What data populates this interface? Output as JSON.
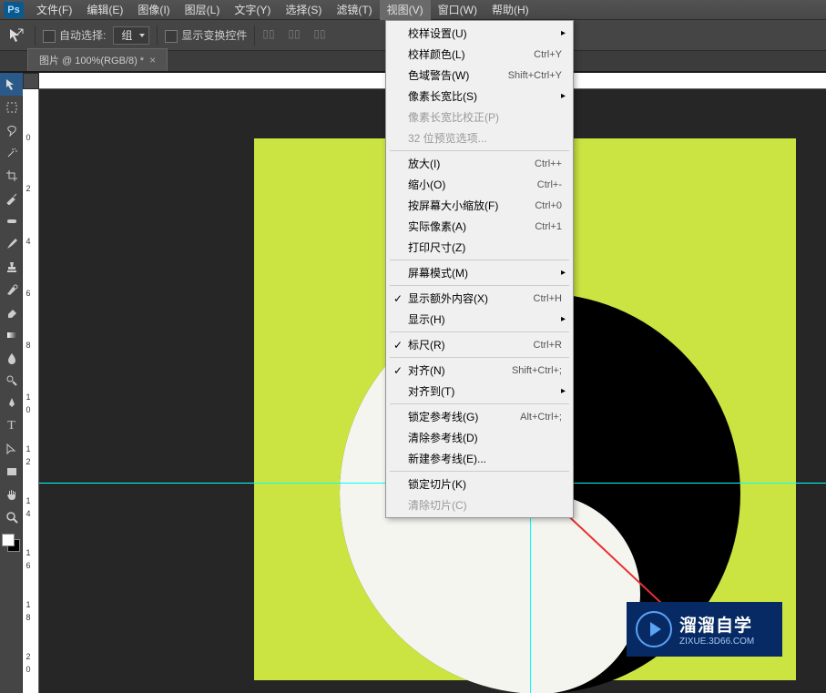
{
  "app_logo": "Ps",
  "menubar": [
    "文件(F)",
    "编辑(E)",
    "图像(I)",
    "图层(L)",
    "文字(Y)",
    "选择(S)",
    "滤镜(T)",
    "视图(V)",
    "窗口(W)",
    "帮助(H)"
  ],
  "active_menu_index": 7,
  "options": {
    "auto_select_label": "自动选择:",
    "group_label": "组",
    "transform_controls_label": "显示变换控件"
  },
  "document_tab": "图片 @ 100%(RGB/8) *",
  "ruler_v_labels": [
    "0",
    "2",
    "4",
    "6",
    "8",
    "1\n0",
    "1\n2",
    "1\n4",
    "1\n6",
    "1\n8",
    "2\n0"
  ],
  "dropdown": {
    "items": [
      {
        "label": "校样设置(U)",
        "submenu": true
      },
      {
        "label": "校样颜色(L)",
        "shortcut": "Ctrl+Y"
      },
      {
        "label": "色域警告(W)",
        "shortcut": "Shift+Ctrl+Y"
      },
      {
        "label": "像素长宽比(S)",
        "submenu": true
      },
      {
        "label": "像素长宽比校正(P)",
        "disabled": true
      },
      {
        "label": "32 位预览选项...",
        "disabled": true
      },
      {
        "sep": true
      },
      {
        "label": "放大(I)",
        "shortcut": "Ctrl++"
      },
      {
        "label": "缩小(O)",
        "shortcut": "Ctrl+-"
      },
      {
        "label": "按屏幕大小缩放(F)",
        "shortcut": "Ctrl+0"
      },
      {
        "label": "实际像素(A)",
        "shortcut": "Ctrl+1"
      },
      {
        "label": "打印尺寸(Z)"
      },
      {
        "sep": true
      },
      {
        "label": "屏幕模式(M)",
        "submenu": true
      },
      {
        "sep": true
      },
      {
        "label": "显示额外内容(X)",
        "shortcut": "Ctrl+H",
        "checked": true
      },
      {
        "label": "显示(H)",
        "submenu": true
      },
      {
        "sep": true
      },
      {
        "label": "标尺(R)",
        "shortcut": "Ctrl+R",
        "checked": true
      },
      {
        "sep": true
      },
      {
        "label": "对齐(N)",
        "shortcut": "Shift+Ctrl+;",
        "checked": true
      },
      {
        "label": "对齐到(T)",
        "submenu": true
      },
      {
        "sep": true
      },
      {
        "label": "锁定参考线(G)",
        "shortcut": "Alt+Ctrl+;"
      },
      {
        "label": "清除参考线(D)"
      },
      {
        "label": "新建参考线(E)..."
      },
      {
        "sep": true
      },
      {
        "label": "锁定切片(K)"
      },
      {
        "label": "清除切片(C)",
        "disabled": true
      }
    ]
  },
  "watermark": {
    "title": "溜溜自学",
    "subtitle": "ZIXUE.3D66.COM"
  },
  "canvas": {
    "bg_color": "#cbe441"
  }
}
